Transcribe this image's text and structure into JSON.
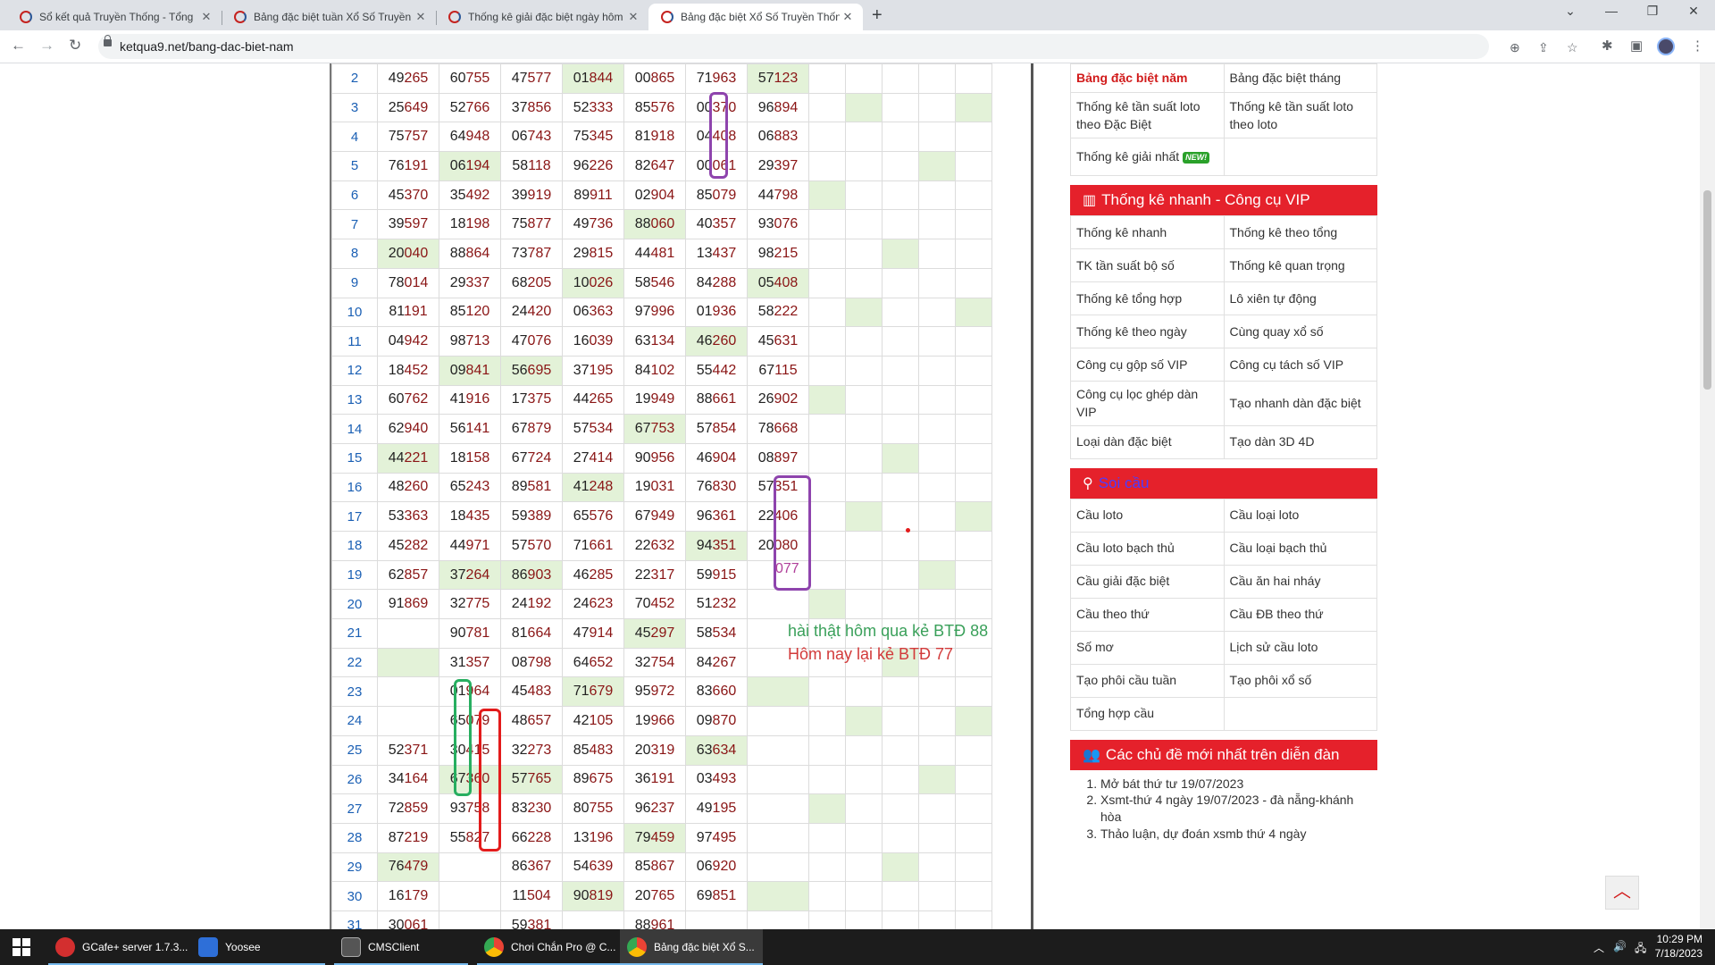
{
  "browser": {
    "tabs": [
      {
        "title": "Sổ kết quả Truyền Thống - Tổng",
        "active": false
      },
      {
        "title": "Bảng đặc biệt tuần Xổ Số Truyền",
        "active": false
      },
      {
        "title": "Thống kê giải đặc biệt ngày hôm",
        "active": false
      },
      {
        "title": "Bảng đặc biệt Xổ Số Truyền Thốn",
        "active": true
      }
    ],
    "new_tab": "+",
    "url": "ketqua9.net/bang-dac-biet-nam",
    "back": "←",
    "forward": "→",
    "reload": "↻",
    "win_buttons": [
      "⌄",
      "—",
      "❐",
      "✕"
    ]
  },
  "lottery_table": {
    "rows": [
      {
        "n": "2",
        "v": [
          "49265",
          "60755",
          "47577",
          "01844",
          "00865",
          "71963",
          "57123"
        ],
        "g": [
          3,
          6
        ]
      },
      {
        "n": "3",
        "v": [
          "25649",
          "52766",
          "37856",
          "52333",
          "85576",
          "00370",
          "96894"
        ],
        "g": [
          8,
          11
        ]
      },
      {
        "n": "4",
        "v": [
          "75757",
          "64948",
          "06743",
          "75345",
          "81918",
          "04408",
          "06883"
        ],
        "g": []
      },
      {
        "n": "5",
        "v": [
          "76191",
          "06194",
          "58118",
          "96226",
          "82647",
          "00061",
          "29397"
        ],
        "g": [
          1,
          10
        ]
      },
      {
        "n": "6",
        "v": [
          "45370",
          "35492",
          "39919",
          "89911",
          "02904",
          "85079",
          "44798"
        ],
        "g": [
          7
        ]
      },
      {
        "n": "7",
        "v": [
          "39597",
          "18198",
          "75877",
          "49736",
          "88060",
          "40357",
          "93076"
        ],
        "g": [
          4
        ]
      },
      {
        "n": "8",
        "v": [
          "20040",
          "88864",
          "73787",
          "29815",
          "44481",
          "13437",
          "98215"
        ],
        "g": [
          0,
          9
        ]
      },
      {
        "n": "9",
        "v": [
          "78014",
          "29337",
          "68205",
          "10026",
          "58546",
          "84288",
          "05408"
        ],
        "g": [
          3,
          6
        ]
      },
      {
        "n": "10",
        "v": [
          "81191",
          "85120",
          "24420",
          "06363",
          "97996",
          "01936",
          "58222"
        ],
        "g": [
          8,
          11
        ]
      },
      {
        "n": "11",
        "v": [
          "04942",
          "98713",
          "47076",
          "16039",
          "63134",
          "46260",
          "45631"
        ],
        "g": [
          5
        ]
      },
      {
        "n": "12",
        "v": [
          "18452",
          "09841",
          "56695",
          "37195",
          "84102",
          "55442",
          "67115"
        ],
        "g": [
          1,
          2
        ]
      },
      {
        "n": "13",
        "v": [
          "60762",
          "41916",
          "17375",
          "44265",
          "19949",
          "88661",
          "26902"
        ],
        "g": [
          7
        ]
      },
      {
        "n": "14",
        "v": [
          "62940",
          "56141",
          "67879",
          "57534",
          "67753",
          "57854",
          "78668"
        ],
        "g": [
          4
        ]
      },
      {
        "n": "15",
        "v": [
          "44221",
          "18158",
          "67724",
          "27414",
          "90956",
          "46904",
          "08897"
        ],
        "g": [
          0,
          9
        ]
      },
      {
        "n": "16",
        "v": [
          "48260",
          "65243",
          "89581",
          "41248",
          "19031",
          "76830",
          "57351"
        ],
        "g": [
          3
        ]
      },
      {
        "n": "17",
        "v": [
          "53363",
          "18435",
          "59389",
          "65576",
          "67949",
          "96361",
          "22406"
        ],
        "g": [
          8,
          11
        ]
      },
      {
        "n": "18",
        "v": [
          "45282",
          "44971",
          "57570",
          "71661",
          "22632",
          "94351",
          "20080"
        ],
        "g": [
          5
        ]
      },
      {
        "n": "19",
        "v": [
          "62857",
          "37264",
          "86903",
          "46285",
          "22317",
          "59915",
          ""
        ],
        "g": [
          1,
          2,
          10
        ]
      },
      {
        "n": "20",
        "v": [
          "91869",
          "32775",
          "24192",
          "24623",
          "70452",
          "51232",
          ""
        ],
        "g": [
          7
        ]
      },
      {
        "n": "21",
        "v": [
          "",
          "90781",
          "81664",
          "47914",
          "45297",
          "58534",
          ""
        ],
        "g": [
          4
        ]
      },
      {
        "n": "22",
        "v": [
          "",
          "31357",
          "08798",
          "64652",
          "32754",
          "84267",
          ""
        ],
        "g": [
          0,
          9
        ]
      },
      {
        "n": "23",
        "v": [
          "",
          "01964",
          "45483",
          "71679",
          "95972",
          "83660",
          ""
        ],
        "g": [
          3,
          6
        ]
      },
      {
        "n": "24",
        "v": [
          "",
          "65079",
          "48657",
          "42105",
          "19966",
          "09870",
          ""
        ],
        "g": [
          8,
          11
        ]
      },
      {
        "n": "25",
        "v": [
          "52371",
          "30415",
          "32273",
          "85483",
          "20319",
          "63634",
          ""
        ],
        "g": [
          5
        ]
      },
      {
        "n": "26",
        "v": [
          "34164",
          "67360",
          "57765",
          "89675",
          "36191",
          "03493",
          ""
        ],
        "g": [
          1,
          2,
          10
        ]
      },
      {
        "n": "27",
        "v": [
          "72859",
          "93758",
          "83230",
          "80755",
          "96237",
          "49195",
          ""
        ],
        "g": [
          7
        ]
      },
      {
        "n": "28",
        "v": [
          "87219",
          "55827",
          "66228",
          "13196",
          "79459",
          "97495",
          ""
        ],
        "g": [
          4
        ]
      },
      {
        "n": "29",
        "v": [
          "76479",
          "",
          "86367",
          "54639",
          "85867",
          "06920",
          ""
        ],
        "g": [
          0,
          9
        ]
      },
      {
        "n": "30",
        "v": [
          "16179",
          "",
          "11504",
          "90819",
          "20765",
          "69851",
          ""
        ],
        "g": [
          3,
          6
        ]
      },
      {
        "n": "31",
        "v": [
          "30061",
          "",
          "59381",
          "",
          "88961",
          "",
          ""
        ],
        "g": []
      }
    ]
  },
  "annotations": {
    "note1": "hài thật hôm qua kẻ BTĐ 88",
    "note2": "Hôm nay lại kẻ BTĐ 77",
    "note3": "077"
  },
  "sidebar": {
    "top_links": [
      [
        "Bảng đặc biệt năm",
        "Bảng đặc biệt tháng"
      ],
      [
        "Thống kê tần suất loto theo Đặc Biệt",
        "Thống kê tần suất loto theo loto"
      ],
      [
        "Thống kê giải nhất",
        ""
      ]
    ],
    "new_badge": "NEW!",
    "vip_title": "Thống kê nhanh - Công cụ VIP",
    "vip_links": [
      [
        "Thống kê nhanh",
        "Thống kê theo tổng"
      ],
      [
        "TK tần suất bộ số",
        "Thống kê quan trọng"
      ],
      [
        "Thống kê tổng hợp",
        "Lô xiên tự động"
      ],
      [
        "Thống kê theo ngày",
        "Cùng quay xổ số"
      ],
      [
        "Công cụ gộp số VIP",
        "Công cụ tách số VIP"
      ],
      [
        "Công cụ lọc ghép dàn VIP",
        "Tạo nhanh dàn đặc biệt"
      ],
      [
        "Loại dàn đặc biệt",
        "Tạo dàn 3D 4D"
      ]
    ],
    "soi_title": "Soi cầu",
    "soi_links": [
      [
        "Cầu loto",
        "Cầu loại loto"
      ],
      [
        "Cầu loto bạch thủ",
        "Cầu loại bạch thủ"
      ],
      [
        "Cầu giải đặc biệt",
        "Cầu ăn hai nháy"
      ],
      [
        "Cầu theo thứ",
        "Cầu ĐB theo thứ"
      ],
      [
        "Số mơ",
        "Lịch sử cầu loto"
      ],
      [
        "Tạo phôi cầu tuần",
        "Tạo phôi xổ số"
      ],
      [
        "Tổng hợp cầu",
        ""
      ]
    ],
    "forum_title": "Các chủ đề mới nhất trên diễn đàn",
    "forum_items": [
      "Mở bát thứ tư 19/07/2023",
      "Xsmt-thứ 4 ngày 19/07/2023 - đà nẵng-khánh hòa",
      "Thảo luận, dự đoán xsmb thứ 4 ngày"
    ]
  },
  "taskbar": {
    "items": [
      "GCafe+ server 1.7.3...",
      "Yoosee",
      "CMSClient",
      "Chơi Chắn Pro @ C...",
      "Bảng đặc biệt Xổ S..."
    ],
    "time": "10:29 PM",
    "date": "7/18/2023"
  }
}
